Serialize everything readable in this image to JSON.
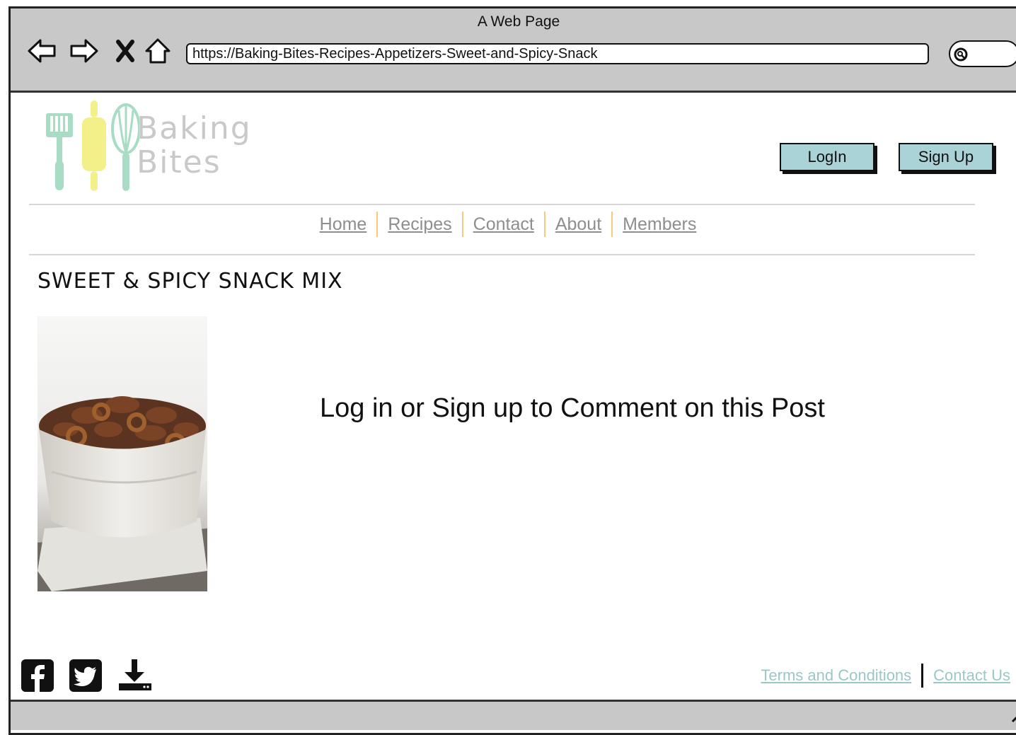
{
  "window": {
    "title": "A Web Page",
    "url": "https://Baking-Bites-Recipes-Appetizers-Sweet-and-Spicy-Snack"
  },
  "logo": {
    "line1": "Baking",
    "line2": "Bites",
    "colors": {
      "green": "#a8dcc4",
      "yellow": "#f3f08a"
    }
  },
  "header": {
    "login_label": "LogIn",
    "signup_label": "Sign Up",
    "button_color": "#a9d3d6"
  },
  "nav": {
    "items": [
      "Home",
      "Recipes",
      "Contact",
      "About",
      "Members"
    ],
    "separator_color": "#f7c97a"
  },
  "post": {
    "title": "SWEET & SPICY SNACK MIX",
    "cta": "Log in or Sign up to Comment on this Post"
  },
  "footer": {
    "icons": [
      "facebook-icon",
      "twitter-icon",
      "download-icon"
    ],
    "terms_label": "Terms and Conditions",
    "contact_label": "Contact Us",
    "link_color": "#9cc6c8"
  }
}
